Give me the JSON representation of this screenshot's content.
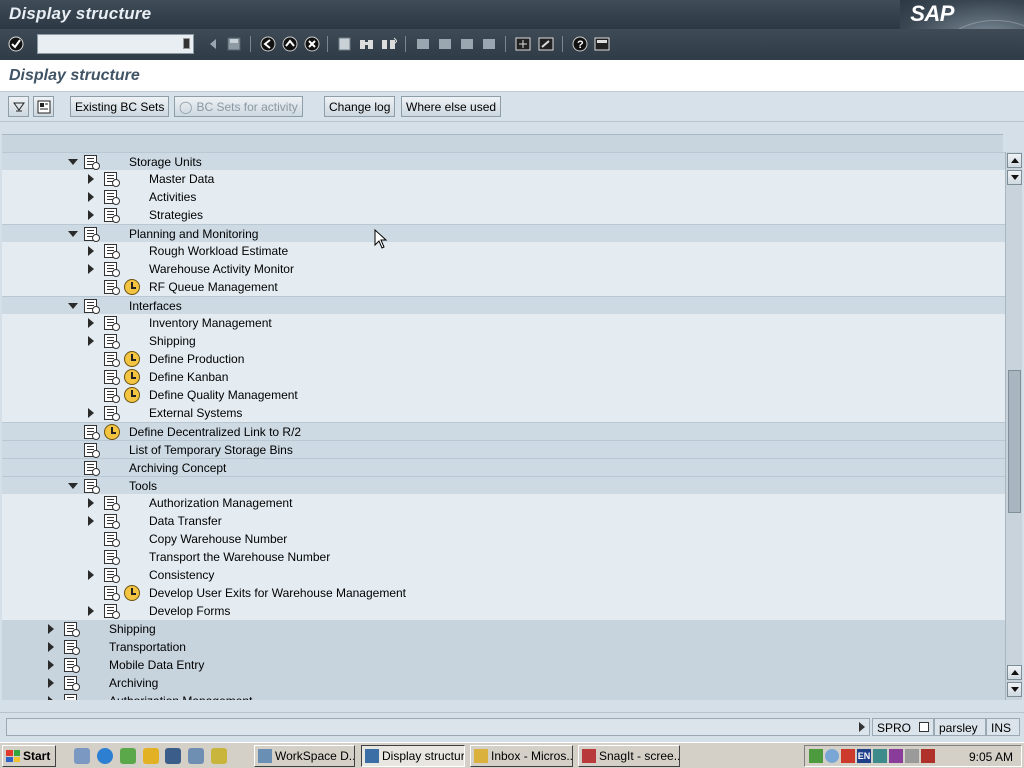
{
  "window": {
    "title": "Display structure",
    "logo_text": "SAP"
  },
  "system_toolbar": {
    "command_field_value": "",
    "icons": [
      "enter-check-icon",
      "back-icon",
      "save-icon",
      "back-arrow-icon",
      "exit-icon",
      "cancel-icon",
      "print-icon",
      "find-icon",
      "find-next-icon",
      "first-page-icon",
      "previous-page-icon",
      "next-page-icon",
      "last-page-icon",
      "create-session-icon",
      "shortcut-icon",
      "help-icon",
      "customize-layout-icon"
    ]
  },
  "screen": {
    "title": "Display structure"
  },
  "app_toolbar": {
    "existing_bc_sets": "Existing BC Sets",
    "bc_sets_for_activity": "BC Sets for activity",
    "change_log": "Change log",
    "where_else_used": "Where else used"
  },
  "tree": [
    {
      "label": "Storage Units",
      "level": 1,
      "expand": "open",
      "clock": false
    },
    {
      "label": "Master Data",
      "level": 2,
      "expand": "closed",
      "clock": false
    },
    {
      "label": "Activities",
      "level": 2,
      "expand": "closed",
      "clock": false
    },
    {
      "label": "Strategies",
      "level": 2,
      "expand": "closed",
      "clock": false
    },
    {
      "label": "Planning and Monitoring",
      "level": 1,
      "expand": "open",
      "clock": false
    },
    {
      "label": "Rough Workload Estimate",
      "level": 2,
      "expand": "closed",
      "clock": false
    },
    {
      "label": "Warehouse Activity Monitor",
      "level": 2,
      "expand": "closed",
      "clock": false
    },
    {
      "label": "RF Queue Management",
      "level": 2,
      "expand": "none",
      "clock": true
    },
    {
      "label": "Interfaces",
      "level": 1,
      "expand": "open",
      "clock": false
    },
    {
      "label": "Inventory Management",
      "level": 2,
      "expand": "closed",
      "clock": false
    },
    {
      "label": "Shipping",
      "level": 2,
      "expand": "closed",
      "clock": false
    },
    {
      "label": "Define Production",
      "level": 2,
      "expand": "none",
      "clock": true
    },
    {
      "label": "Define Kanban",
      "level": 2,
      "expand": "none",
      "clock": true
    },
    {
      "label": "Define Quality Management",
      "level": 2,
      "expand": "none",
      "clock": true
    },
    {
      "label": "External Systems",
      "level": 2,
      "expand": "closed",
      "clock": false
    },
    {
      "label": "Define Decentralized Link to R/2",
      "level": 1,
      "expand": "none",
      "clock": true
    },
    {
      "label": "List of Temporary Storage Bins",
      "level": 1,
      "expand": "none",
      "clock": false
    },
    {
      "label": "Archiving Concept",
      "level": 1,
      "expand": "none",
      "clock": false
    },
    {
      "label": "Tools",
      "level": 1,
      "expand": "open",
      "clock": false
    },
    {
      "label": "Authorization Management",
      "level": 2,
      "expand": "closed",
      "clock": false
    },
    {
      "label": "Data Transfer",
      "level": 2,
      "expand": "closed",
      "clock": false
    },
    {
      "label": "Copy Warehouse Number",
      "level": 2,
      "expand": "none",
      "clock": false
    },
    {
      "label": "Transport the Warehouse Number",
      "level": 2,
      "expand": "none",
      "clock": false
    },
    {
      "label": "Consistency",
      "level": 2,
      "expand": "closed",
      "clock": false
    },
    {
      "label": "Develop User Exits for Warehouse Management",
      "level": 2,
      "expand": "none",
      "clock": true
    },
    {
      "label": "Develop Forms",
      "level": 2,
      "expand": "closed",
      "clock": false
    },
    {
      "label": "Shipping",
      "level": 0,
      "expand": "closed",
      "clock": false
    },
    {
      "label": "Transportation",
      "level": 0,
      "expand": "closed",
      "clock": false
    },
    {
      "label": "Mobile Data Entry",
      "level": 0,
      "expand": "closed",
      "clock": false
    },
    {
      "label": "Archiving",
      "level": 0,
      "expand": "closed",
      "clock": false
    },
    {
      "label": "Authorization Management",
      "level": 0,
      "expand": "closed",
      "clock": false
    }
  ],
  "scrollbar": {
    "position": 0.55,
    "visible_fraction": 0.3
  },
  "status_bar": {
    "message": "",
    "transaction": "SPRO",
    "user": "parsley",
    "mode": "INS"
  },
  "taskbar": {
    "start_label": "Start",
    "buttons": [
      {
        "label": "WorkSpace D...",
        "active": false,
        "color": "#6a8fb5"
      },
      {
        "label": "Display structure",
        "active": true,
        "color": "#3a6ea5"
      },
      {
        "label": "Inbox - Micros...",
        "active": false,
        "color": "#d9b13c"
      },
      {
        "label": "SnagIt - scree...",
        "active": false,
        "color": "#b83a3a"
      }
    ],
    "tray_language": "EN",
    "clock": "9:05 AM"
  },
  "colors": {
    "title_bar": "#2f3b46",
    "tree_level1_bg": "#cddae3",
    "tree_level2_bg": "#e4ecf2",
    "tree_level0_bg": "#c7d3dd"
  }
}
